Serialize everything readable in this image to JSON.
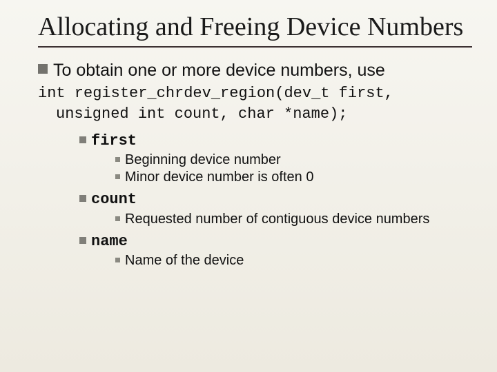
{
  "title": "Allocating and Freeing Device Numbers",
  "intro": "To obtain one or more device numbers, use",
  "code": {
    "line1": "int register_chrdev_region(dev_t first,",
    "line2": "unsigned int count, char *name);"
  },
  "params": [
    {
      "name": "first",
      "details": [
        "Beginning device number",
        "Minor device number is often 0"
      ]
    },
    {
      "name": "count",
      "details": [
        "Requested number of contiguous device numbers"
      ]
    },
    {
      "name": "name",
      "details": [
        "Name of the device"
      ]
    }
  ]
}
